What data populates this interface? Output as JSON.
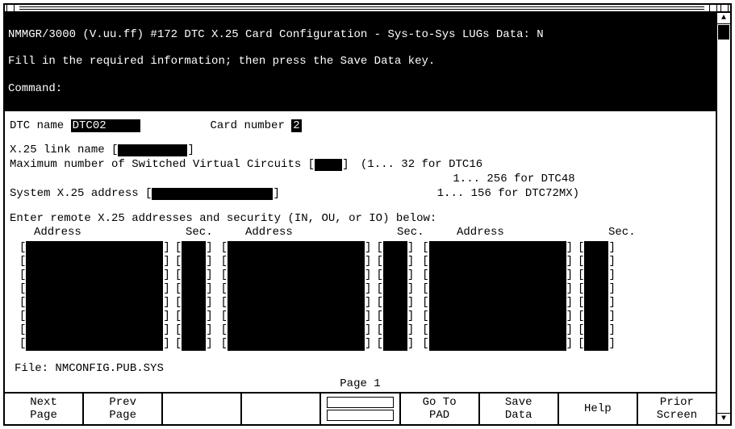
{
  "header": {
    "line1": "NMMGR/3000 (V.uu.ff) #172 DTC X.25 Card Configuration - Sys-to-Sys LUGs Data: N",
    "line2": "Fill in the required information; then press the Save Data key.",
    "command_label": "Command:"
  },
  "fields": {
    "dtc_name_label": "DTC name ",
    "dtc_name_value": "DTC02   ",
    "card_number_label": "Card number ",
    "card_number_value": "2",
    "x25_link_label": "X.25 link name ",
    "x25_link_value": "",
    "max_svc_label": "Maximum number of Switched Virtual Circuits ",
    "max_svc_value": "",
    "max_svc_hint1": "(1... 32  for DTC16",
    "max_svc_hint2": " 1... 256 for DTC48",
    "max_svc_hint3": " 1... 156 for DTC72MX)",
    "sys_x25_addr_label": "System X.25 address ",
    "sys_x25_addr_value": ""
  },
  "grid": {
    "intro": " Enter remote X.25 addresses and security (IN, OU, or IO) below:",
    "col_address": "Address",
    "col_sec": "Sec.",
    "rows": 8,
    "groups": 3
  },
  "footer": {
    "file_label": "File:  ",
    "file_value": "NMCONFIG.PUB.SYS",
    "page": "Page 1"
  },
  "fkeys": [
    {
      "l1": "Next",
      "l2": "Page"
    },
    {
      "l1": "Prev",
      "l2": "Page"
    },
    {
      "l1": "",
      "l2": ""
    },
    {
      "l1": "",
      "l2": ""
    },
    {
      "l1": "",
      "l2": "",
      "split": true
    },
    {
      "l1": "Go To",
      "l2": "PAD"
    },
    {
      "l1": "Save",
      "l2": "Data"
    },
    {
      "l1": "Help",
      "l2": ""
    },
    {
      "l1": "Prior",
      "l2": "Screen"
    }
  ]
}
